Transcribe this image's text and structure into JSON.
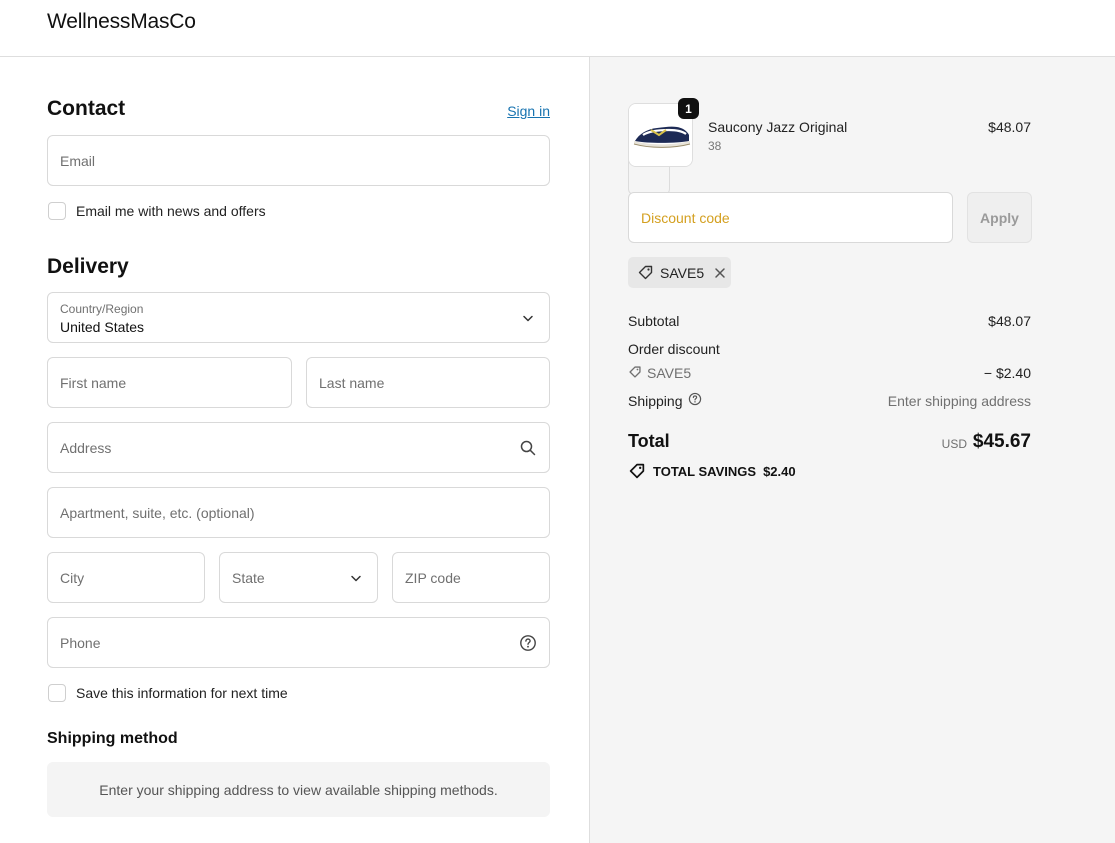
{
  "header": {
    "shop_name": "WellnessMasCo"
  },
  "contact": {
    "title": "Contact",
    "signin_label": "Sign in",
    "email_placeholder": "Email",
    "news_label": "Email me with news and offers"
  },
  "delivery": {
    "title": "Delivery",
    "country_label": "Country/Region",
    "country_value": "United States",
    "first_name_placeholder": "First name",
    "last_name_placeholder": "Last name",
    "address_placeholder": "Address",
    "apartment_placeholder": "Apartment, suite, etc. (optional)",
    "city_placeholder": "City",
    "state_placeholder": "State",
    "zip_placeholder": "ZIP code",
    "phone_placeholder": "Phone",
    "save_info_label": "Save this information for next time"
  },
  "shipping_method": {
    "title": "Shipping method",
    "message": "Enter your shipping address to view available shipping methods."
  },
  "summary": {
    "item": {
      "quantity": "1",
      "name": "Saucony Jazz Original",
      "variant": "38",
      "price": "$48.07"
    },
    "discount_placeholder": "Discount code",
    "apply_label": "Apply",
    "applied_code": "SAVE5",
    "subtotal_label": "Subtotal",
    "subtotal_value": "$48.07",
    "order_discount_label": "Order discount",
    "discount_code": "SAVE5",
    "discount_value": "− $2.40",
    "shipping_label": "Shipping",
    "shipping_value": "Enter shipping address",
    "total_label": "Total",
    "currency": "USD",
    "total_value": "$45.67",
    "savings_label": "TOTAL SAVINGS",
    "savings_value": "$2.40"
  },
  "icons": {
    "select_chevron": "chevron-down-icon",
    "address_search": "search-icon",
    "phone_help": "help-circle-icon",
    "discount_tag": "tag-icon",
    "remove_code": "close-icon"
  },
  "colors": {
    "link": "#1773b0",
    "discount_placeholder": "#d4a020",
    "summary_bg": "#f5f5f5"
  }
}
